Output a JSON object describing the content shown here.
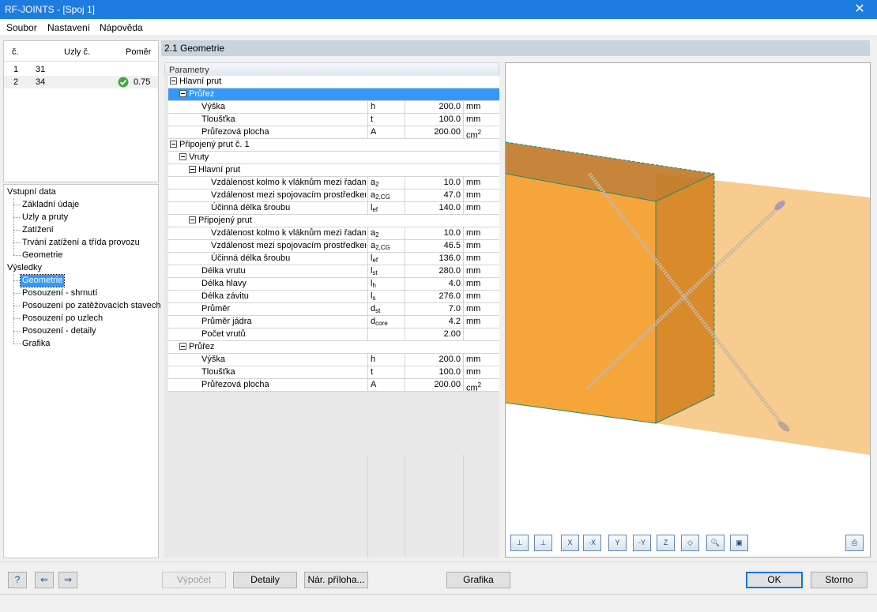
{
  "window": {
    "title": "RF-JOINTS - [Spoj 1]",
    "close_glyph": "✕"
  },
  "menu": [
    "Soubor",
    "Nastavení",
    "Nápověda"
  ],
  "nodes_table": {
    "headers": {
      "no": "č.",
      "nodes": "Uzly č.",
      "ratio": "Poměr"
    },
    "rows": [
      {
        "no": "1",
        "node": "31",
        "ratio": ""
      },
      {
        "no": "2",
        "node": "34",
        "ratio": "0.75"
      }
    ]
  },
  "nav": {
    "input_group": "Vstupní data",
    "input_items": [
      "Základní údaje",
      "Uzly a pruty",
      "Zatížení",
      "Trvání zatížení a třída provozu",
      "Geometrie"
    ],
    "results_group": "Výsledky",
    "results_items": [
      "Geometrie",
      "Posouzení - shrnutí",
      "Posouzení po zatěžovacích stavech",
      "Posouzení po uzlech",
      "Posouzení - detaily",
      "Grafika"
    ],
    "selected": "Geometrie"
  },
  "section_title": "2.1 Geometrie",
  "params_tab": "Parametry",
  "rows": [
    {
      "label": "Hlavní prut",
      "sym": "",
      "sub": "",
      "val": "",
      "unit": "",
      "level": 0,
      "group": true
    },
    {
      "label": "Průřez",
      "sym": "",
      "sub": "",
      "val": "",
      "unit": "",
      "level": 1,
      "group": true,
      "highlight": true
    },
    {
      "label": "Výška",
      "sym": "h",
      "sub": "",
      "val": "200.0",
      "unit": "mm",
      "level": 2
    },
    {
      "label": "Tloušťka",
      "sym": "t",
      "sub": "",
      "val": "100.0",
      "unit": "mm",
      "level": 2
    },
    {
      "label": "Průřezová plocha",
      "sym": "A",
      "sub": "",
      "val": "200.00",
      "unit": "cm",
      "unit_sup": "2",
      "level": 2
    },
    {
      "label": "Připojený prut č. 1",
      "sym": "",
      "sub": "",
      "val": "",
      "unit": "",
      "level": 0,
      "group": true
    },
    {
      "label": "Vruty",
      "sym": "",
      "sub": "",
      "val": "",
      "unit": "",
      "level": 1,
      "group": true
    },
    {
      "label": "Hlavní prut",
      "sym": "",
      "sub": "",
      "val": "",
      "unit": "",
      "level": 2,
      "group": true
    },
    {
      "label": "Vzdálenost kolmo k vláknům mezi řadami",
      "sym": "a",
      "sub": "2",
      "val": "10.0",
      "unit": "mm",
      "level": 3
    },
    {
      "label": "Vzdálenost mezi spojovacím prostředkem",
      "sym": "a",
      "sub": "2,CG",
      "val": "47.0",
      "unit": "mm",
      "level": 3
    },
    {
      "label": "Účinná délka šroubu",
      "sym": "l",
      "sub": "ef",
      "val": "140.0",
      "unit": "mm",
      "level": 3
    },
    {
      "label": "Připojený prut",
      "sym": "",
      "sub": "",
      "val": "",
      "unit": "",
      "level": 2,
      "group": true
    },
    {
      "label": "Vzdálenost kolmo k vláknům mezi řadami",
      "sym": "a",
      "sub": "2",
      "val": "10.0",
      "unit": "mm",
      "level": 3
    },
    {
      "label": "Vzdálenost mezi spojovacím prostředkem",
      "sym": "a",
      "sub": "2,CG",
      "val": "46.5",
      "unit": "mm",
      "level": 3
    },
    {
      "label": "Účinná délka šroubu",
      "sym": "l",
      "sub": "ef",
      "val": "136.0",
      "unit": "mm",
      "level": 3
    },
    {
      "label": "Délka vrutu",
      "sym": "l",
      "sub": "st",
      "val": "280.0",
      "unit": "mm",
      "level": 2
    },
    {
      "label": "Délka hlavy",
      "sym": "l",
      "sub": "h",
      "val": "4.0",
      "unit": "mm",
      "level": 2
    },
    {
      "label": "Délka závitu",
      "sym": "l",
      "sub": "s",
      "val": "276.0",
      "unit": "mm",
      "level": 2
    },
    {
      "label": "Průměr",
      "sym": "d",
      "sub": "st",
      "val": "7.0",
      "unit": "mm",
      "level": 2
    },
    {
      "label": "Průměr jádra",
      "sym": "d",
      "sub": "core",
      "val": "4.2",
      "unit": "mm",
      "level": 2
    },
    {
      "label": "Počet vrutů",
      "sym": "",
      "sub": "",
      "val": "2.00",
      "unit": "",
      "level": 2
    },
    {
      "label": "Průřez",
      "sym": "",
      "sub": "",
      "val": "",
      "unit": "",
      "level": 1,
      "group": true
    },
    {
      "label": "Výška",
      "sym": "h",
      "sub": "",
      "val": "200.0",
      "unit": "mm",
      "level": 2
    },
    {
      "label": "Tloušťka",
      "sym": "t",
      "sub": "",
      "val": "100.0",
      "unit": "mm",
      "level": 2
    },
    {
      "label": "Průřezová plocha",
      "sym": "A",
      "sub": "",
      "val": "200.00",
      "unit": "cm",
      "unit_sup": "2",
      "level": 2
    }
  ],
  "viewer_toolbar": [
    {
      "name": "view-front-icon",
      "label": "⊥"
    },
    {
      "name": "view-back-icon",
      "label": "⊥"
    },
    {
      "name": "view-x-icon",
      "label": "X"
    },
    {
      "name": "view-minus-x-icon",
      "label": "-X"
    },
    {
      "name": "view-y-icon",
      "label": "Y"
    },
    {
      "name": "view-minus-y-icon",
      "label": "-Y"
    },
    {
      "name": "view-z-icon",
      "label": "Z"
    },
    {
      "name": "iso-view-icon",
      "label": "◇"
    },
    {
      "name": "zoom-tool-icon",
      "label": "🔍"
    },
    {
      "name": "layers-icon",
      "label": "▣"
    },
    {
      "name": "print-icon",
      "label": "⎙"
    }
  ],
  "buttons": {
    "calc": "Výpočet",
    "details": "Detaily",
    "annex": "Nár. příloha...",
    "graphics": "Grafika",
    "ok": "OK",
    "cancel": "Storno"
  },
  "colors": {
    "title_bar": "#1e7be0",
    "selection": "#3399ff",
    "beam_main": "#f5a53a",
    "beam_conn": "#c97a22"
  }
}
